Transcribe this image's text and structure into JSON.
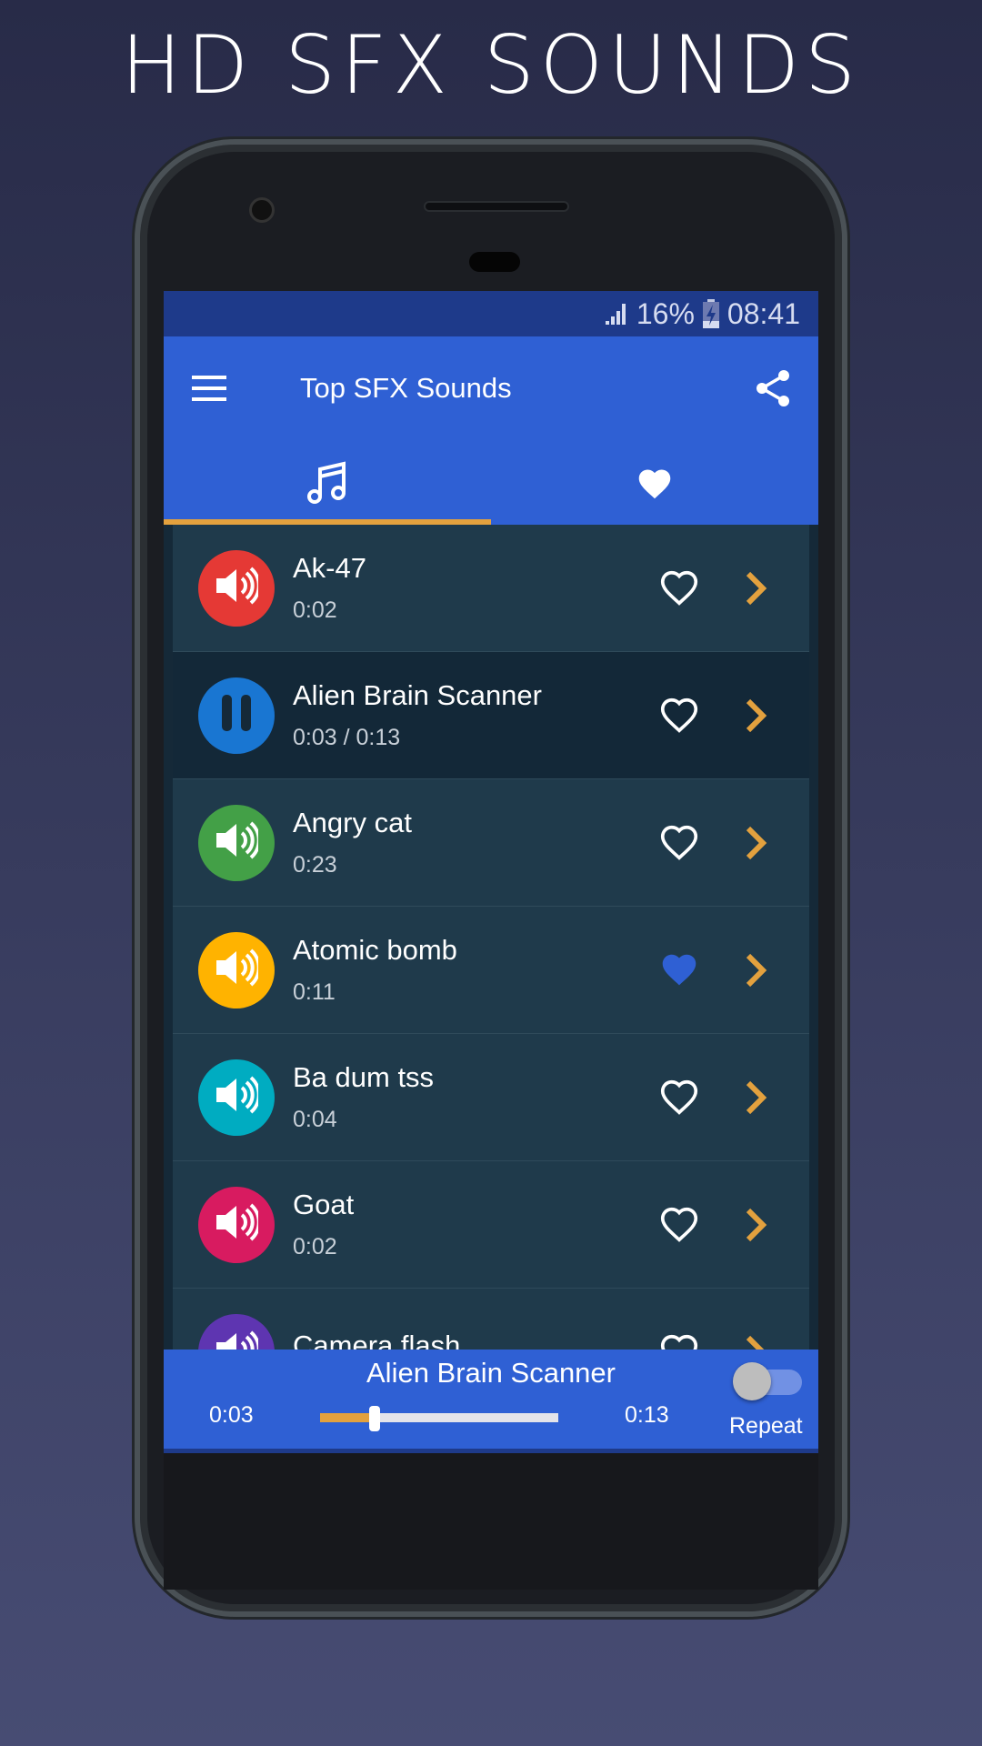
{
  "headline": "HD SFX SOUNDS",
  "status_bar": {
    "battery": "16%",
    "time": "08:41",
    "icons": [
      "signal-icon",
      "battery-charging-icon"
    ]
  },
  "app_bar": {
    "title": "Top SFX Sounds",
    "icons": [
      "menu-icon",
      "share-icon"
    ]
  },
  "tabs": [
    {
      "icon": "music-note-icon",
      "selected": true
    },
    {
      "icon": "heart-icon",
      "selected": false
    }
  ],
  "colors": {
    "accent": "#e3a13e",
    "primary": "#2f60d4",
    "status": "#1e3a8a",
    "favorite": "#2f60d4"
  },
  "sounds": [
    {
      "name": "Ak-47",
      "duration": "0:02",
      "color": "#e53935",
      "state": "speaker",
      "favorite": false
    },
    {
      "name": "Alien Brain Scanner",
      "duration": "0:03 / 0:13",
      "color": "#1976d2",
      "state": "pause",
      "favorite": false
    },
    {
      "name": "Angry cat",
      "duration": "0:23",
      "color": "#43a047",
      "state": "speaker",
      "favorite": false
    },
    {
      "name": "Atomic bomb",
      "duration": "0:11",
      "color": "#ffb300",
      "state": "speaker",
      "favorite": true
    },
    {
      "name": "Ba dum tss",
      "duration": "0:04",
      "color": "#00acc1",
      "state": "speaker",
      "favorite": false
    },
    {
      "name": "Goat",
      "duration": "0:02",
      "color": "#d81b60",
      "state": "speaker",
      "favorite": false
    },
    {
      "name": "Camera flash",
      "duration": "",
      "color": "#5e35b1",
      "state": "speaker",
      "favorite": false
    }
  ],
  "player": {
    "title": "Alien Brain Scanner",
    "current": "0:03",
    "total": "0:13",
    "progress_fraction": 0.23,
    "repeat_label": "Repeat",
    "repeat_on": false
  }
}
